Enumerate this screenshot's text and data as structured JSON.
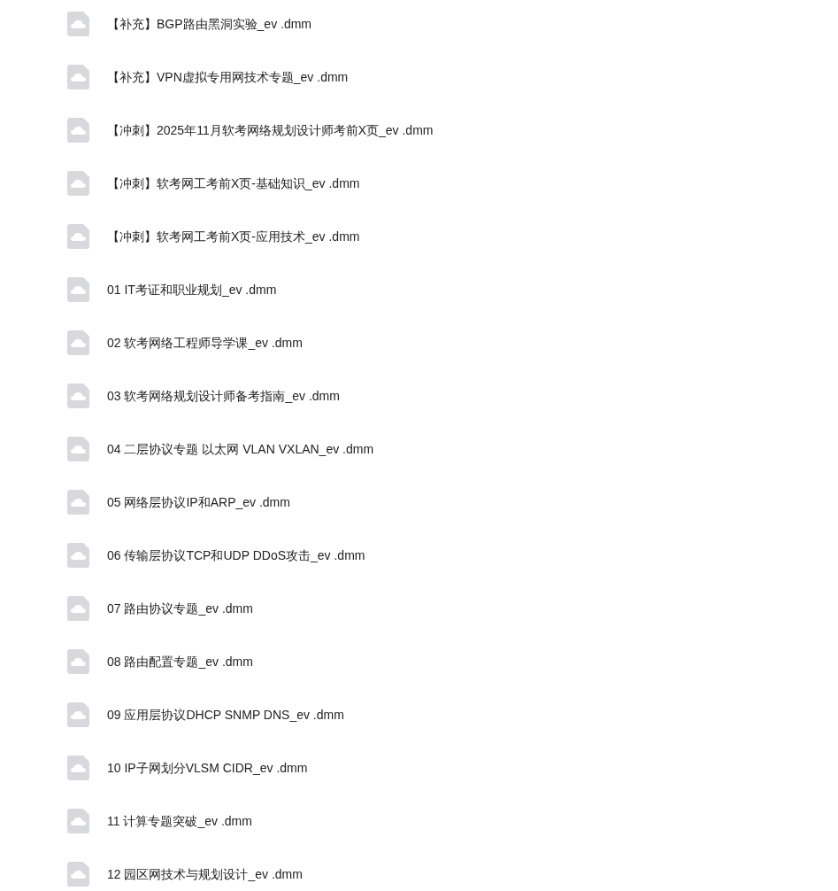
{
  "files": [
    {
      "name": "【补充】BGP路由黑洞实验_ev .dmm"
    },
    {
      "name": "【补充】VPN虚拟专用网技术专题_ev .dmm"
    },
    {
      "name": "【冲刺】2025年11月软考网络规划设计师考前X页_ev .dmm"
    },
    {
      "name": "【冲刺】软考网工考前X页-基础知识_ev .dmm"
    },
    {
      "name": "【冲刺】软考网工考前X页-应用技术_ev .dmm"
    },
    {
      "name": "01 IT考证和职业规划_ev .dmm"
    },
    {
      "name": "02 软考网络工程师导学课_ev .dmm"
    },
    {
      "name": "03 软考网络规划设计师备考指南_ev .dmm"
    },
    {
      "name": "04 二层协议专题 以太网 VLAN VXLAN_ev .dmm"
    },
    {
      "name": "05 网络层协议IP和ARP_ev .dmm"
    },
    {
      "name": "06 传输层协议TCP和UDP DDoS攻击_ev .dmm"
    },
    {
      "name": "07 路由协议专题_ev .dmm"
    },
    {
      "name": "08 路由配置专题_ev .dmm"
    },
    {
      "name": "09 应用层协议DHCP SNMP DNS_ev .dmm"
    },
    {
      "name": "10 IP子网划分VLSM CIDR_ev .dmm"
    },
    {
      "name": "11 计算专题突破_ev .dmm"
    },
    {
      "name": "12 园区网技术与规划设计_ev .dmm"
    }
  ]
}
